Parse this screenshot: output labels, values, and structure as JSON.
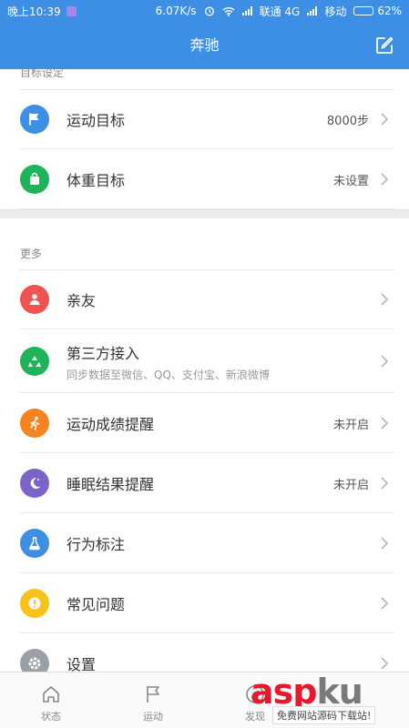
{
  "status_bar": {
    "time": "晚上10:39",
    "speed": "6.07K/s",
    "carrier1_net": "联通 4G",
    "carrier2": "移动",
    "battery": "62%",
    "battery_level": 0.62
  },
  "header": {
    "title": "奔驰"
  },
  "goals": {
    "section_title": "目标设定",
    "items": [
      {
        "label": "运动目标",
        "value": "8000步",
        "icon": "flag-icon",
        "color": "#3d8fe6"
      },
      {
        "label": "体重目标",
        "value": "未设置",
        "icon": "bag-icon",
        "color": "#1fb35a"
      }
    ]
  },
  "more": {
    "section_title": "更多",
    "items": [
      {
        "label": "亲友",
        "value": "",
        "icon": "person-icon",
        "color": "#f0524f"
      },
      {
        "label": "第三方接入",
        "sub": "同步数据至微信、QQ、支付宝、新浪微博",
        "value": "",
        "icon": "recycle-icon",
        "color": "#1fb35a"
      },
      {
        "label": "运动成绩提醒",
        "value": "未开启",
        "icon": "runner-icon",
        "color": "#f5831f"
      },
      {
        "label": "睡眠结果提醒",
        "value": "未开启",
        "icon": "moon-icon",
        "color": "#7b64c8"
      },
      {
        "label": "行为标注",
        "value": "",
        "icon": "flask-icon",
        "color": "#3d8fe6"
      },
      {
        "label": "常见问题",
        "value": "",
        "icon": "exclamation-icon",
        "color": "#f7c21a"
      },
      {
        "label": "设置",
        "value": "",
        "icon": "gear-icon",
        "color": "#9aa0a6"
      }
    ]
  },
  "tabs": [
    {
      "label": "状态",
      "icon": "home-icon"
    },
    {
      "label": "运动",
      "icon": "flag-outline-icon"
    },
    {
      "label": "发现",
      "icon": "compass-icon"
    },
    {
      "label": "",
      "icon": ""
    }
  ],
  "watermark": {
    "brand_asp": "asp",
    "brand_ku": "ku",
    "tagline": "免费网站源码下载站!"
  },
  "colors": {
    "primary": "#3d8fe6",
    "background": "#f2f2f2"
  }
}
